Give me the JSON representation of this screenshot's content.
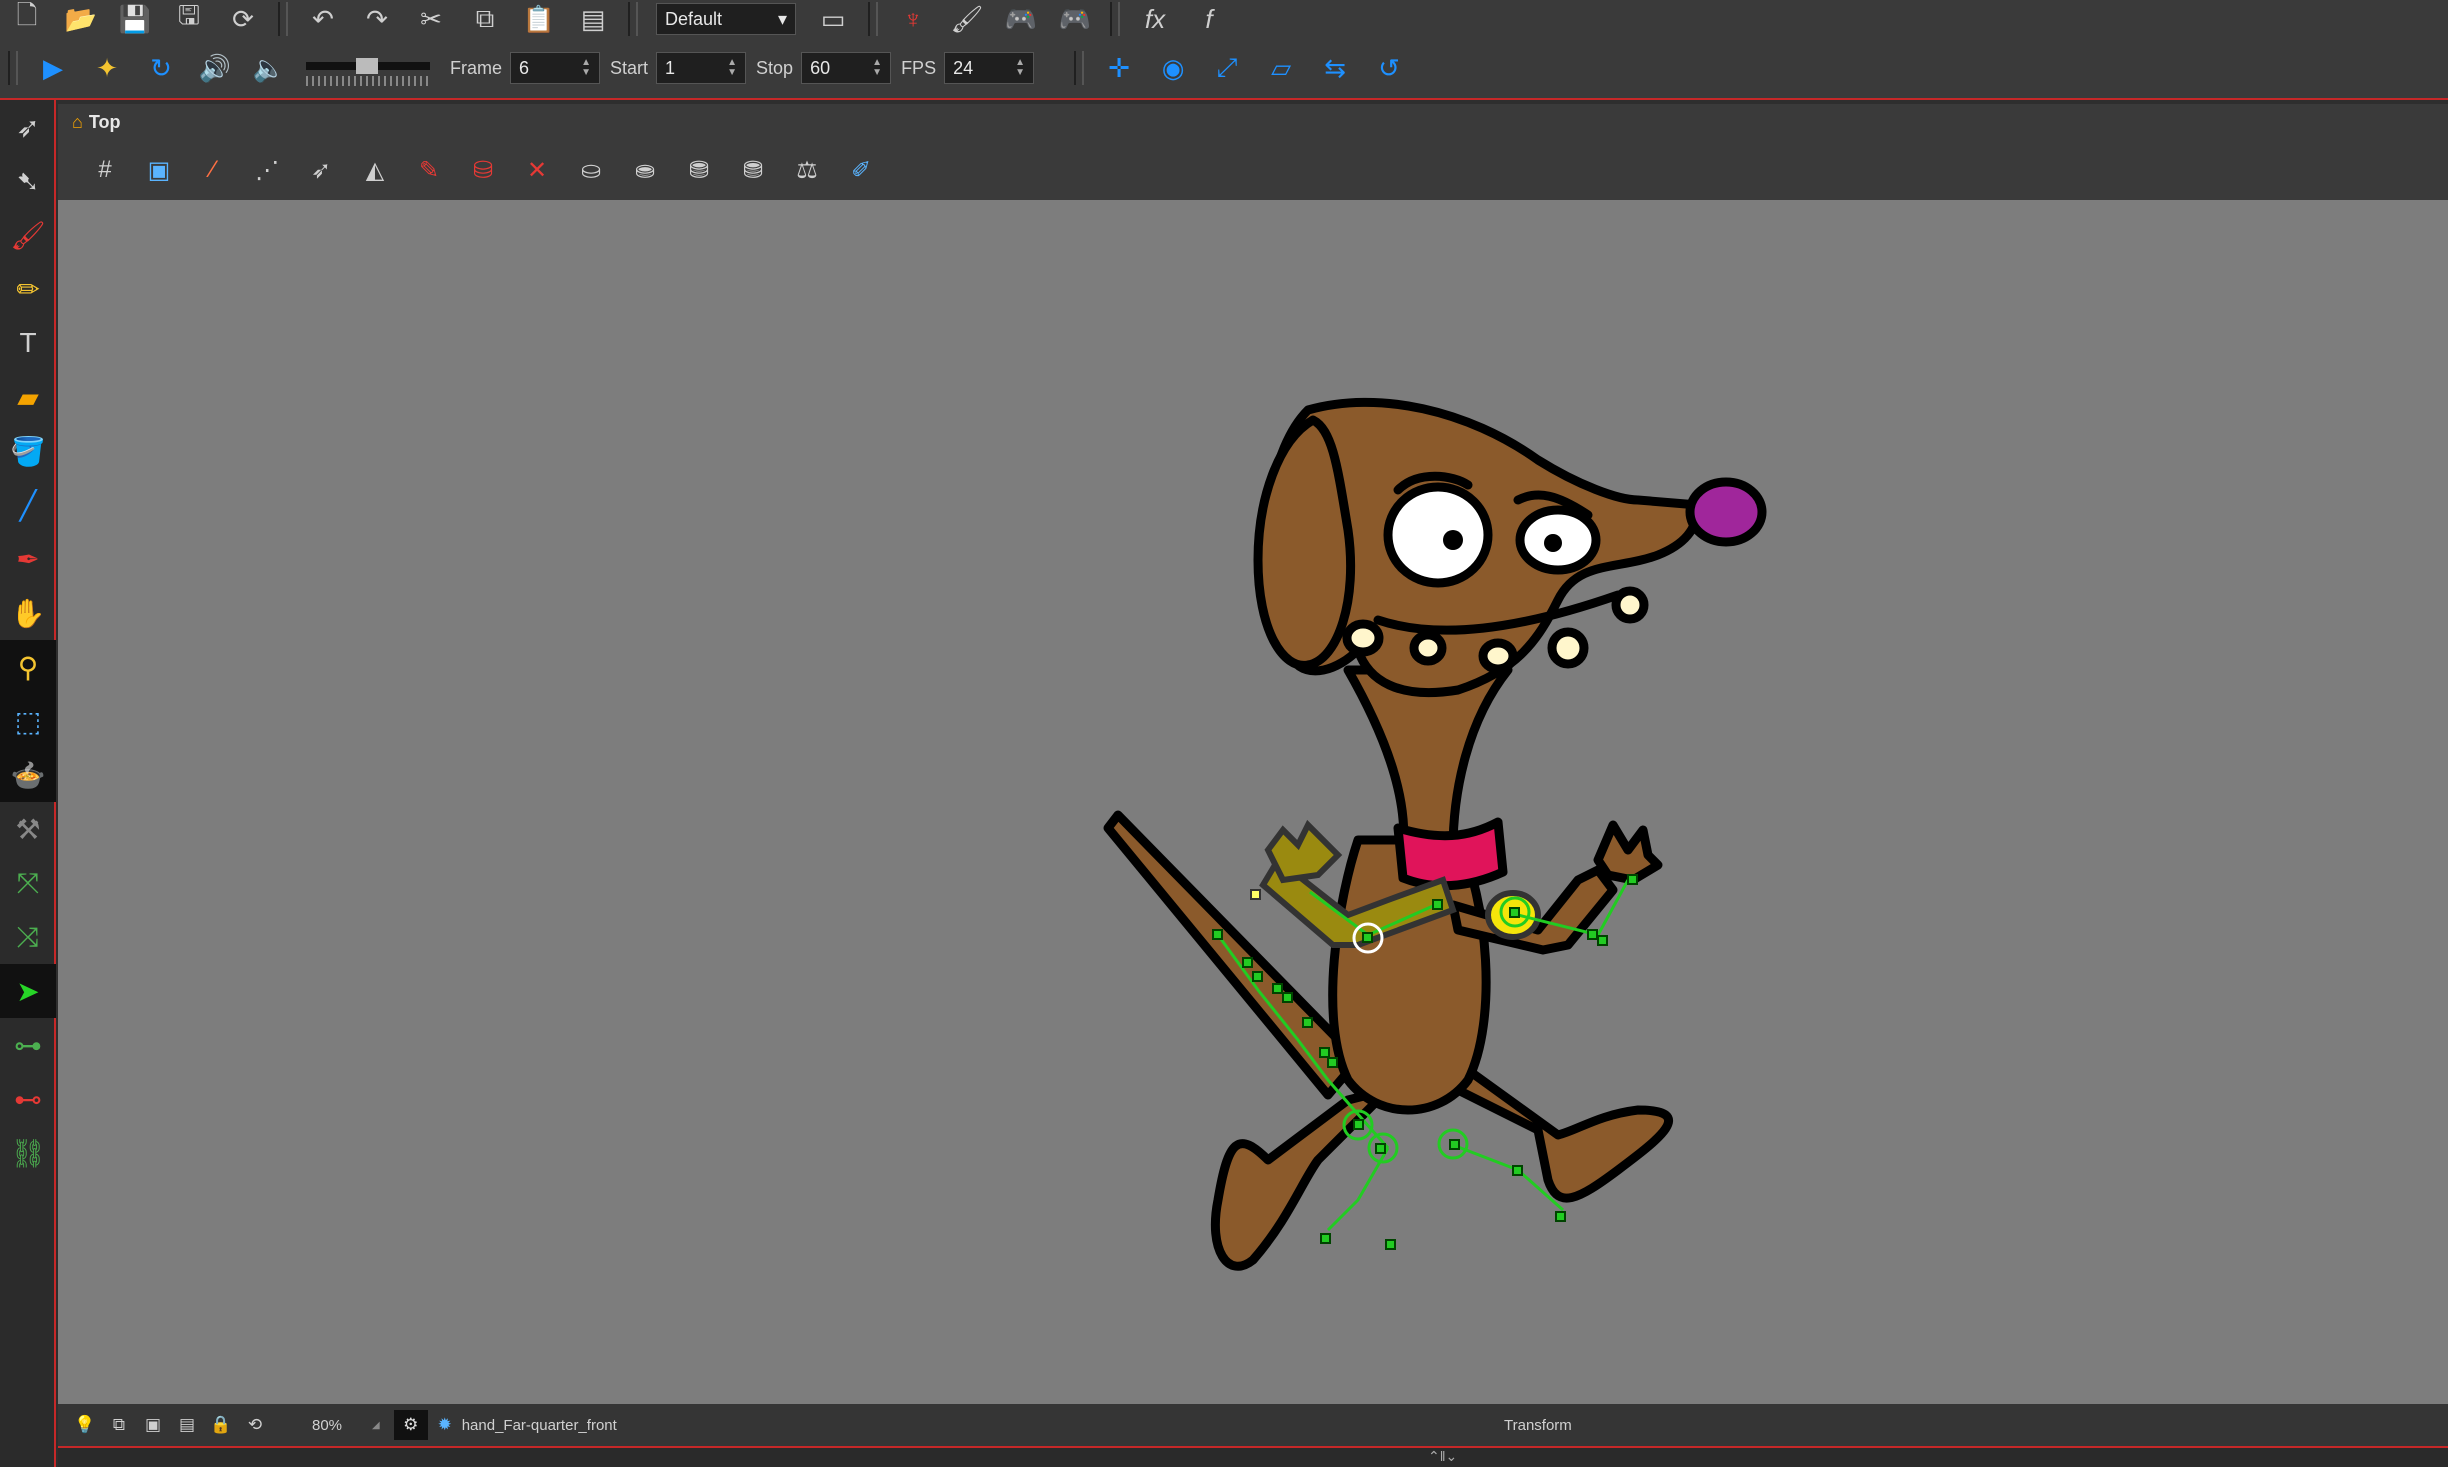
{
  "toolbar": {
    "workspace_value": "Default",
    "frame_label": "Frame",
    "frame_value": "6",
    "start_label": "Start",
    "start_value": "1",
    "stop_label": "Stop",
    "stop_value": "60",
    "fps_label": "FPS",
    "fps_value": "24"
  },
  "view": {
    "title": "Top"
  },
  "status": {
    "zoom": "80%",
    "layer_name": "hand_Far-quarter_front",
    "mode": "Transform"
  },
  "colors": {
    "canvas": "#7d7d7d",
    "accent_red": "#c62828",
    "dog_brown": "#8b5a2b",
    "collar": "#e0145a",
    "nose": "#a0269b",
    "peg_green": "#22cc22"
  }
}
